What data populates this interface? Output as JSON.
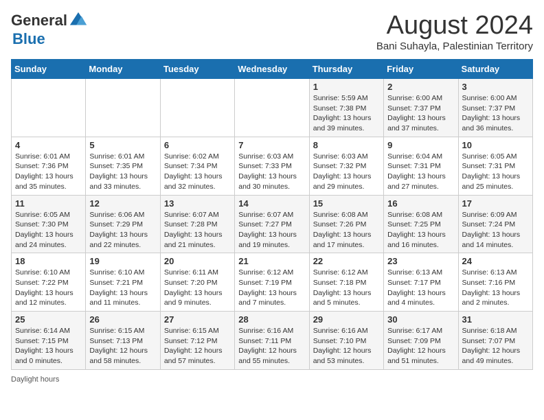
{
  "header": {
    "logo_general": "General",
    "logo_blue": "Blue",
    "month_title": "August 2024",
    "subtitle": "Bani Suhayla, Palestinian Territory"
  },
  "calendar": {
    "days_of_week": [
      "Sunday",
      "Monday",
      "Tuesday",
      "Wednesday",
      "Thursday",
      "Friday",
      "Saturday"
    ],
    "weeks": [
      [
        {
          "day": "",
          "info": ""
        },
        {
          "day": "",
          "info": ""
        },
        {
          "day": "",
          "info": ""
        },
        {
          "day": "",
          "info": ""
        },
        {
          "day": "1",
          "info": "Sunrise: 5:59 AM\nSunset: 7:38 PM\nDaylight: 13 hours and 39 minutes."
        },
        {
          "day": "2",
          "info": "Sunrise: 6:00 AM\nSunset: 7:37 PM\nDaylight: 13 hours and 37 minutes."
        },
        {
          "day": "3",
          "info": "Sunrise: 6:00 AM\nSunset: 7:37 PM\nDaylight: 13 hours and 36 minutes."
        }
      ],
      [
        {
          "day": "4",
          "info": "Sunrise: 6:01 AM\nSunset: 7:36 PM\nDaylight: 13 hours and 35 minutes."
        },
        {
          "day": "5",
          "info": "Sunrise: 6:01 AM\nSunset: 7:35 PM\nDaylight: 13 hours and 33 minutes."
        },
        {
          "day": "6",
          "info": "Sunrise: 6:02 AM\nSunset: 7:34 PM\nDaylight: 13 hours and 32 minutes."
        },
        {
          "day": "7",
          "info": "Sunrise: 6:03 AM\nSunset: 7:33 PM\nDaylight: 13 hours and 30 minutes."
        },
        {
          "day": "8",
          "info": "Sunrise: 6:03 AM\nSunset: 7:32 PM\nDaylight: 13 hours and 29 minutes."
        },
        {
          "day": "9",
          "info": "Sunrise: 6:04 AM\nSunset: 7:31 PM\nDaylight: 13 hours and 27 minutes."
        },
        {
          "day": "10",
          "info": "Sunrise: 6:05 AM\nSunset: 7:31 PM\nDaylight: 13 hours and 25 minutes."
        }
      ],
      [
        {
          "day": "11",
          "info": "Sunrise: 6:05 AM\nSunset: 7:30 PM\nDaylight: 13 hours and 24 minutes."
        },
        {
          "day": "12",
          "info": "Sunrise: 6:06 AM\nSunset: 7:29 PM\nDaylight: 13 hours and 22 minutes."
        },
        {
          "day": "13",
          "info": "Sunrise: 6:07 AM\nSunset: 7:28 PM\nDaylight: 13 hours and 21 minutes."
        },
        {
          "day": "14",
          "info": "Sunrise: 6:07 AM\nSunset: 7:27 PM\nDaylight: 13 hours and 19 minutes."
        },
        {
          "day": "15",
          "info": "Sunrise: 6:08 AM\nSunset: 7:26 PM\nDaylight: 13 hours and 17 minutes."
        },
        {
          "day": "16",
          "info": "Sunrise: 6:08 AM\nSunset: 7:25 PM\nDaylight: 13 hours and 16 minutes."
        },
        {
          "day": "17",
          "info": "Sunrise: 6:09 AM\nSunset: 7:24 PM\nDaylight: 13 hours and 14 minutes."
        }
      ],
      [
        {
          "day": "18",
          "info": "Sunrise: 6:10 AM\nSunset: 7:22 PM\nDaylight: 13 hours and 12 minutes."
        },
        {
          "day": "19",
          "info": "Sunrise: 6:10 AM\nSunset: 7:21 PM\nDaylight: 13 hours and 11 minutes."
        },
        {
          "day": "20",
          "info": "Sunrise: 6:11 AM\nSunset: 7:20 PM\nDaylight: 13 hours and 9 minutes."
        },
        {
          "day": "21",
          "info": "Sunrise: 6:12 AM\nSunset: 7:19 PM\nDaylight: 13 hours and 7 minutes."
        },
        {
          "day": "22",
          "info": "Sunrise: 6:12 AM\nSunset: 7:18 PM\nDaylight: 13 hours and 5 minutes."
        },
        {
          "day": "23",
          "info": "Sunrise: 6:13 AM\nSunset: 7:17 PM\nDaylight: 13 hours and 4 minutes."
        },
        {
          "day": "24",
          "info": "Sunrise: 6:13 AM\nSunset: 7:16 PM\nDaylight: 13 hours and 2 minutes."
        }
      ],
      [
        {
          "day": "25",
          "info": "Sunrise: 6:14 AM\nSunset: 7:15 PM\nDaylight: 13 hours and 0 minutes."
        },
        {
          "day": "26",
          "info": "Sunrise: 6:15 AM\nSunset: 7:13 PM\nDaylight: 12 hours and 58 minutes."
        },
        {
          "day": "27",
          "info": "Sunrise: 6:15 AM\nSunset: 7:12 PM\nDaylight: 12 hours and 57 minutes."
        },
        {
          "day": "28",
          "info": "Sunrise: 6:16 AM\nSunset: 7:11 PM\nDaylight: 12 hours and 55 minutes."
        },
        {
          "day": "29",
          "info": "Sunrise: 6:16 AM\nSunset: 7:10 PM\nDaylight: 12 hours and 53 minutes."
        },
        {
          "day": "30",
          "info": "Sunrise: 6:17 AM\nSunset: 7:09 PM\nDaylight: 12 hours and 51 minutes."
        },
        {
          "day": "31",
          "info": "Sunrise: 6:18 AM\nSunset: 7:07 PM\nDaylight: 12 hours and 49 minutes."
        }
      ]
    ]
  },
  "footer": {
    "note": "Daylight hours"
  }
}
